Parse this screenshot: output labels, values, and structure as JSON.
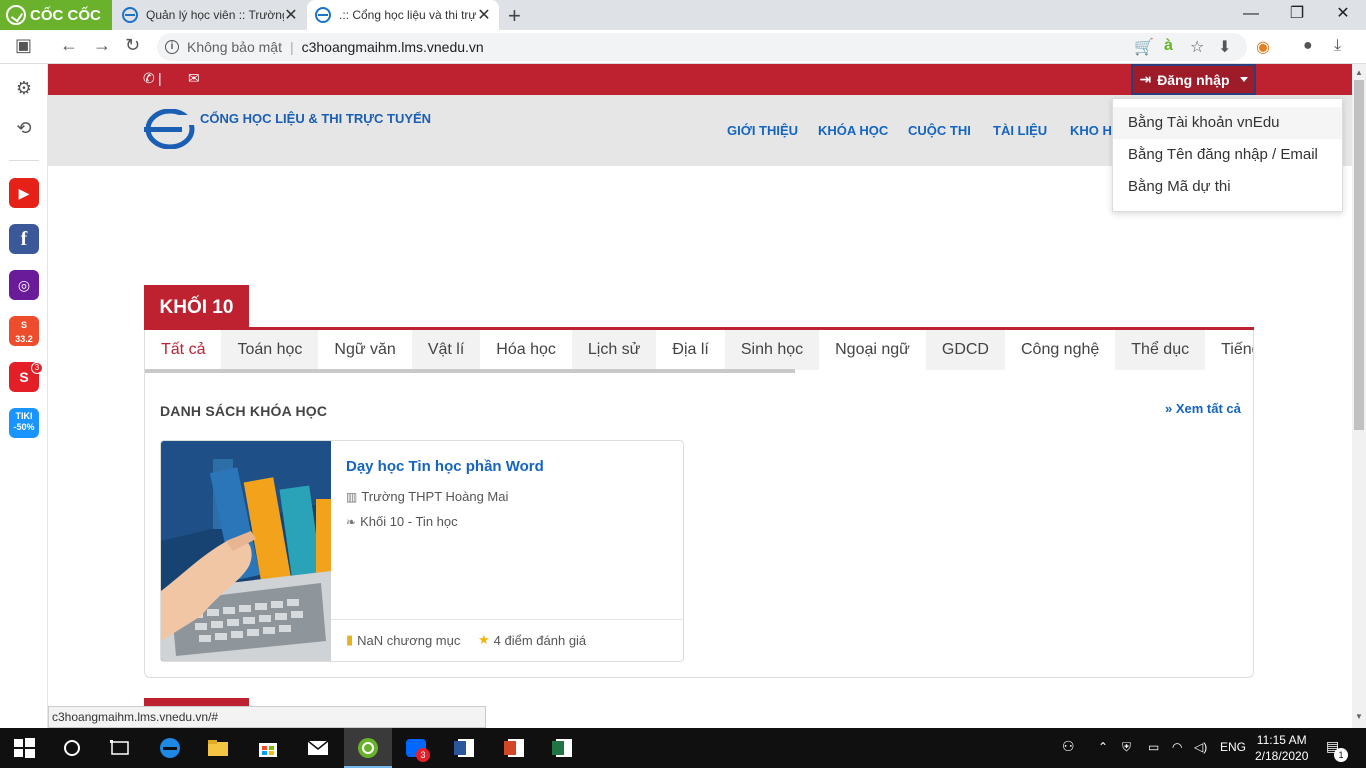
{
  "browser": {
    "brand": "CỐC CỐC",
    "tabs": [
      {
        "label": "Quản lý học viên :: Trường"
      },
      {
        "label": ".:: Cổng học liệu và thi trực"
      }
    ],
    "new_tab": "+",
    "window_controls": {
      "minimize": "—",
      "maximize": "❐",
      "close": "✕"
    },
    "address": {
      "security": "Không bảo mật",
      "separator": "|",
      "url": "c3hoangmaihm.lms.vnedu.vn"
    }
  },
  "sidebar": {
    "icons": [
      "panel-icon",
      "settings-icon",
      "history-icon",
      "youtube-icon",
      "facebook-icon",
      "music-icon",
      "shopee-icon",
      "sendo-icon",
      "tiki-icon"
    ],
    "sendo_badge": "3",
    "shopee_label": "33.2",
    "tiki_label": "TIKI -50%"
  },
  "topbar": {
    "phone_sep": "|",
    "login_label": "Đăng nhập"
  },
  "header": {
    "site_title": "CỔNG HỌC LIỆU & THI TRỰC TUYẾN",
    "nav": [
      "GIỚI THIỆU",
      "KHÓA HỌC",
      "CUỘC THI",
      "TÀI LIỆU",
      "KHO HỌ"
    ]
  },
  "login_menu": {
    "items": [
      "Bằng Tài khoản vnEdu",
      "Bằng Tên đăng nhập / Email",
      "Bằng Mã dự thi"
    ]
  },
  "section": {
    "grade_tab": "KHỐI 10",
    "subjects": [
      "Tất cả",
      "Toán học",
      "Ngữ văn",
      "Vật lí",
      "Hóa học",
      "Lịch sử",
      "Địa lí",
      "Sinh học",
      "Ngoại ngữ",
      "GDCD",
      "Công nghệ",
      "Thể dục",
      "Tiếng c"
    ],
    "active_subject": "Tất cả",
    "list_title": "DANH SÁCH KHÓA HỌC",
    "see_all": "» Xem tất cả"
  },
  "course": {
    "title": "Dạy học Tin học phần Word",
    "school": "Trường THPT Hoàng Mai",
    "grade": "Khối 10 - Tin học",
    "chapters": "NaN chương mục",
    "rating": "4 điểm đánh giá"
  },
  "status_url": "c3hoangmaihm.lms.vnedu.vn/#",
  "taskbar": {
    "lang": "ENG",
    "time": "11:15 AM",
    "date": "2/18/2020",
    "zalo_badge": "3",
    "notif_count": "1"
  },
  "colors": {
    "brand_red": "#be2231",
    "link_blue": "#1565c0",
    "coccoc_green": "#6ab22b"
  }
}
